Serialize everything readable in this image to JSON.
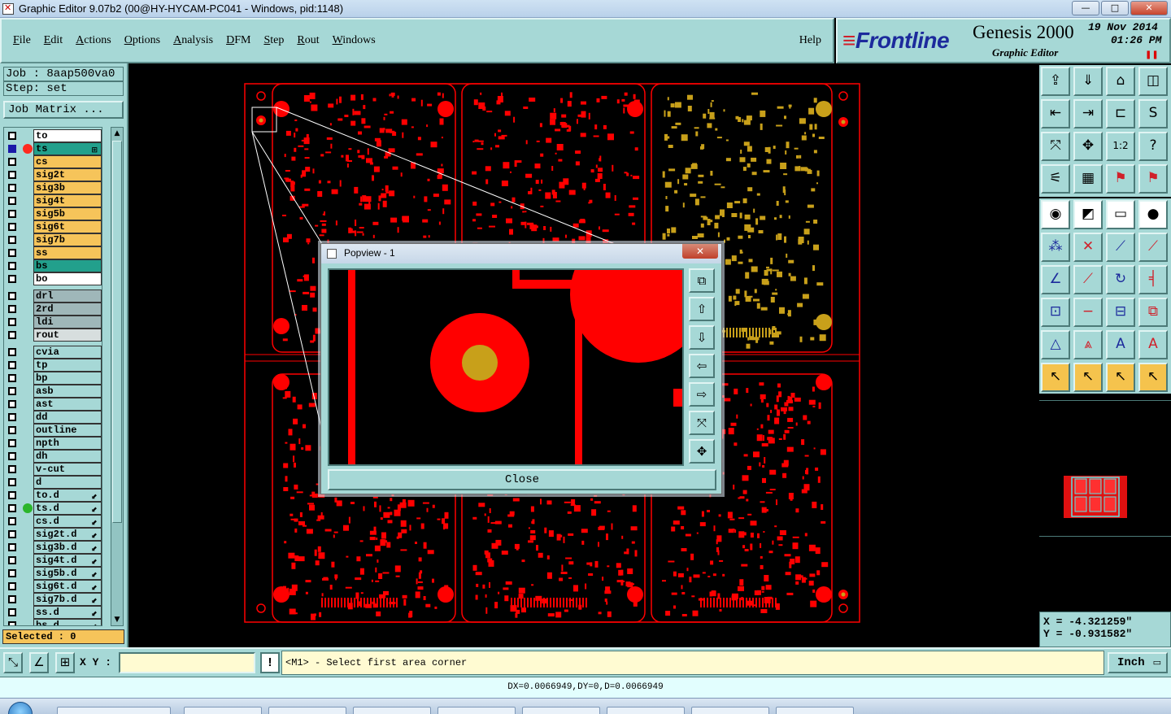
{
  "window": {
    "title": "Graphic Editor 9.07b2 (00@HY-HYCAM-PC041 - Windows, pid:1148)",
    "minimize": "—",
    "maximize": "□",
    "close": "✕"
  },
  "menu": {
    "items": [
      "File",
      "Edit",
      "Actions",
      "Options",
      "Analysis",
      "DFM",
      "Step",
      "Rout",
      "Windows"
    ],
    "help": "Help"
  },
  "brand": {
    "logo": "Frontline",
    "product": "Genesis 2000",
    "subtitle": "Graphic Editor",
    "date": "19 Nov 2014",
    "time": "01:26 PM"
  },
  "job": {
    "job_line": "Job : 8aap500va0",
    "step_line": "Step: set",
    "matrix_button": "Job Matrix ..."
  },
  "layers": [
    {
      "name": "to",
      "color": "#ffffff",
      "group": 0
    },
    {
      "name": "ts",
      "color": "#22a08c",
      "group": 0,
      "selected": true,
      "dot": "#ff2a1f"
    },
    {
      "name": "cs",
      "color": "#f6c45a",
      "group": 0
    },
    {
      "name": "sig2t",
      "color": "#f6c45a",
      "group": 0
    },
    {
      "name": "sig3b",
      "color": "#f6c45a",
      "group": 0
    },
    {
      "name": "sig4t",
      "color": "#f6c45a",
      "group": 0
    },
    {
      "name": "sig5b",
      "color": "#f6c45a",
      "group": 0
    },
    {
      "name": "sig6t",
      "color": "#f6c45a",
      "group": 0
    },
    {
      "name": "sig7b",
      "color": "#f6c45a",
      "group": 0
    },
    {
      "name": "ss",
      "color": "#f6c45a",
      "group": 0
    },
    {
      "name": "bs",
      "color": "#22a08c",
      "group": 0
    },
    {
      "name": "bo",
      "color": "#ffffff",
      "group": 0
    },
    {
      "name": "drl",
      "color": "#9fb7b9",
      "group": 1
    },
    {
      "name": "2rd",
      "color": "#9fb7b9",
      "group": 1
    },
    {
      "name": "ldi",
      "color": "#9fb7b9",
      "group": 1
    },
    {
      "name": "rout",
      "color": "#d7dede",
      "group": 1
    },
    {
      "name": "cvia",
      "color": "#a6d8d6",
      "group": 2
    },
    {
      "name": "tp",
      "color": "#a6d8d6",
      "group": 2
    },
    {
      "name": "bp",
      "color": "#a6d8d6",
      "group": 2
    },
    {
      "name": "asb",
      "color": "#a6d8d6",
      "group": 2
    },
    {
      "name": "ast",
      "color": "#a6d8d6",
      "group": 2
    },
    {
      "name": "dd",
      "color": "#a6d8d6",
      "group": 2
    },
    {
      "name": "outline",
      "color": "#a6d8d6",
      "group": 2
    },
    {
      "name": "npth",
      "color": "#a6d8d6",
      "group": 2
    },
    {
      "name": "dh",
      "color": "#a6d8d6",
      "group": 2
    },
    {
      "name": "v-cut",
      "color": "#a6d8d6",
      "group": 2
    },
    {
      "name": "d",
      "color": "#a6d8d6",
      "group": 2
    },
    {
      "name": "to.d",
      "color": "#a6d8d6",
      "group": 2,
      "arrow": true
    },
    {
      "name": "ts.d",
      "color": "#a6d8d6",
      "group": 2,
      "arrow": true,
      "dot": "#2bb52b"
    },
    {
      "name": "cs.d",
      "color": "#a6d8d6",
      "group": 2,
      "arrow": true
    },
    {
      "name": "sig2t.d",
      "color": "#a6d8d6",
      "group": 2,
      "arrow": true
    },
    {
      "name": "sig3b.d",
      "color": "#a6d8d6",
      "group": 2,
      "arrow": true
    },
    {
      "name": "sig4t.d",
      "color": "#a6d8d6",
      "group": 2,
      "arrow": true
    },
    {
      "name": "sig5b.d",
      "color": "#a6d8d6",
      "group": 2,
      "arrow": true
    },
    {
      "name": "sig6t.d",
      "color": "#a6d8d6",
      "group": 2,
      "arrow": true
    },
    {
      "name": "sig7b.d",
      "color": "#a6d8d6",
      "group": 2,
      "arrow": true
    },
    {
      "name": "ss.d",
      "color": "#a6d8d6",
      "group": 2,
      "arrow": true
    },
    {
      "name": "bs.d",
      "color": "#a6d8d6",
      "group": 2,
      "arrow": true
    }
  ],
  "selected_label": "Selected : 0",
  "popview": {
    "title": "Popview - 1",
    "close_label": "Close",
    "close_x": "✕"
  },
  "coords": {
    "x": "X = -4.321259\"",
    "y": "Y = -0.931582\""
  },
  "bottom": {
    "xy_label": "X Y :",
    "xy_value": "",
    "warn": "!",
    "prompt": "<M1> - Select first area corner",
    "units": "Inch",
    "units_arrow": "▭"
  },
  "status": "DX=0.0066949,DY=0,D=0.0066949",
  "colors": {
    "panel": "#a6d8d6",
    "copper_red": "#ff0000",
    "copper_gold": "#c8a01a",
    "tool_yellow": "#f5c34d"
  },
  "icons": {
    "tools_top": [
      "zoom-home-icon",
      "zoom-back-icon",
      "zoom-home2-icon",
      "window-split-icon",
      "pan-left-icon",
      "pan-right-icon",
      "ratio-icon",
      "snap-s-icon",
      "fit-all-icon",
      "center-icon",
      "scale-12-icon",
      "help-query-icon",
      "measure-icon",
      "grid-icon",
      "layers-red-icon",
      "layers-red2-icon"
    ],
    "tools_bottom": [
      "pad-icon",
      "line-icon",
      "ruler-icon",
      "circle-icon",
      "node-icon",
      "cross-icon",
      "arc-line-icon",
      "arc-point-icon",
      "angle-icon",
      "diagonal-icon",
      "rotate-icon",
      "bracket-icon",
      "select-point-icon",
      "minus-icon",
      "measure-bracket-icon",
      "flip-icon",
      "triangle-icon",
      "triangle-up-icon",
      "triangle-a-icon",
      "triangle-b-icon",
      "pointer-icon",
      "pointer-box-icon",
      "pointer-circle-icon",
      "pointer-net-icon"
    ]
  }
}
